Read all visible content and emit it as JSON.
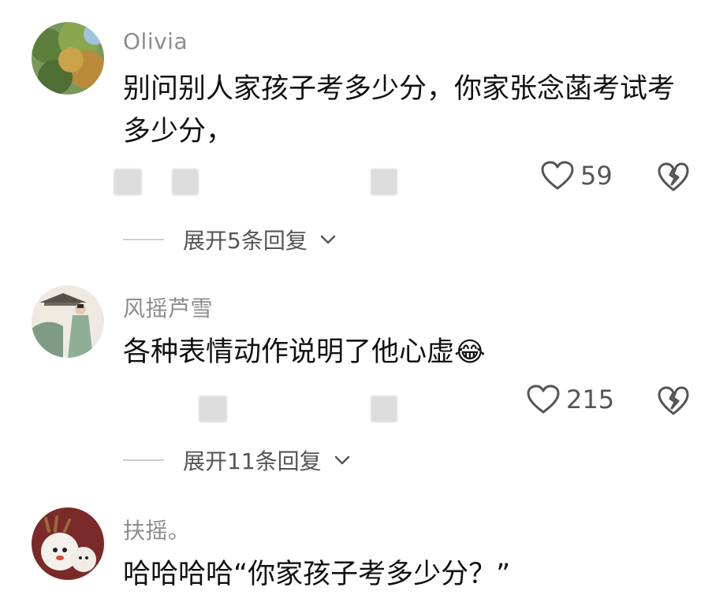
{
  "comments": [
    {
      "username": "Olivia",
      "text": "别问别人家孩子考多少分，你家张念菡考试考多少分，",
      "likes": "59",
      "expand_label": "展开5条回复"
    },
    {
      "username": "风摇芦雪",
      "text": "各种表情动作说明了他心虚",
      "emoji": "😂",
      "likes": "215",
      "expand_label": "展开11条回复"
    },
    {
      "username": "扶摇。",
      "text": "哈哈哈哈“你家孩子考多少分？”"
    }
  ],
  "icons": {
    "like": "heart-outline-icon",
    "dislike": "broken-heart-icon",
    "expand": "chevron-down-icon"
  },
  "colors": {
    "username": "#8c8c8c",
    "text": "#111111",
    "meta": "#555555",
    "divider": "#cfcfcf"
  }
}
